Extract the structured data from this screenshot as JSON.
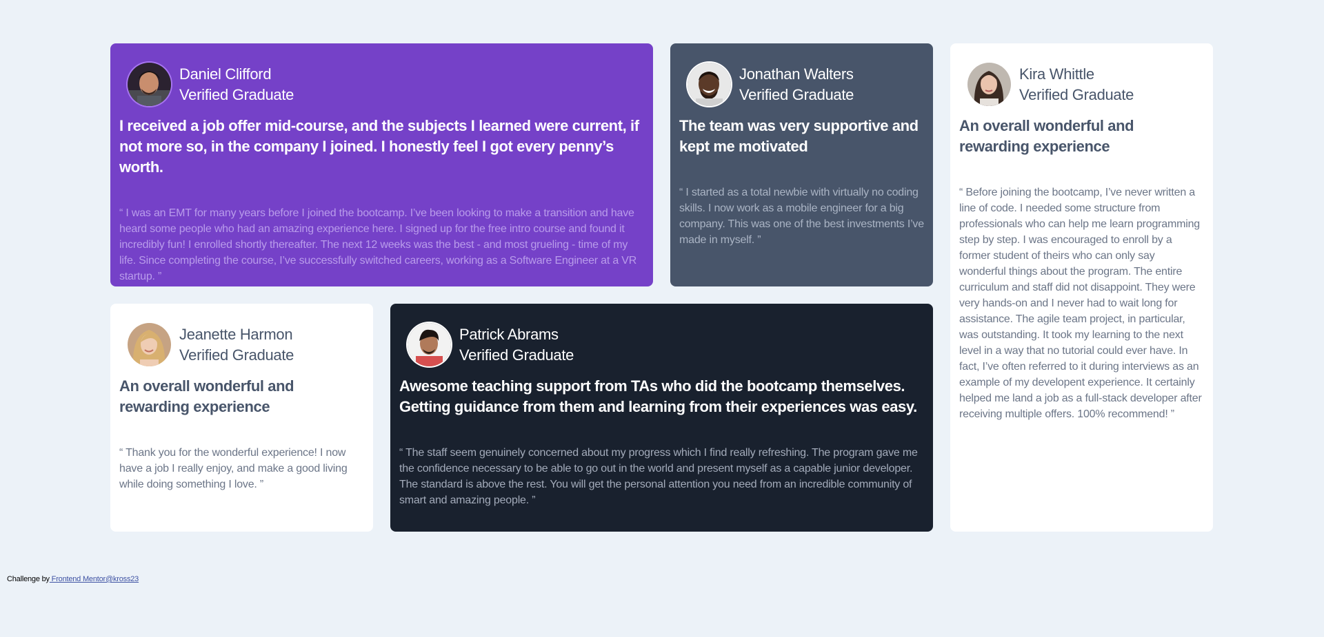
{
  "testimonials": [
    {
      "name": "Daniel Clifford",
      "role": "Verified Graduate",
      "headline": "I received a job offer mid-course, and the subjects I learned were current, if not more so, in the company I joined. I honestly feel I got every penny’s worth.",
      "quote": "“ I was an EMT for many years before I joined the bootcamp. I’ve been looking to make a transition and have heard some people who had an amazing experience here. I signed up for the free intro course and found it incredibly fun! I enrolled shortly thereafter. The next 12 weeks was the best - and most grueling - time of my life. Since completing the course, I’ve successfully switched careers, working as a Software Engineer at a VR startup. ”",
      "background": "#7541c8"
    },
    {
      "name": "Jonathan Walters",
      "role": "Verified Graduate",
      "headline": "The team was very supportive and kept me motivated",
      "quote": "“ I started as a total newbie with virtually no coding skills. I now work as a mobile engineer for a big company. This was one of the best investments I’ve made in myself. ”",
      "background": "#48556a"
    },
    {
      "name": "Kira Whittle",
      "role": "Verified Graduate",
      "headline": "An overall wonderful and rewarding experience",
      "quote": "“ Before joining the bootcamp, I’ve never written a line of code. I needed some structure from professionals who can help me learn programming step by step. I was encouraged to enroll by a former student of theirs who can only say wonderful things about the program. The entire curriculum and staff did not disappoint. They were very hands-on and I never had to wait long for assistance. The agile team project, in particular, was outstanding. It took my learning to the next level in a way that no tutorial could ever have. In fact, I’ve often referred to it during interviews as an example of my developent experience. It certainly helped me land a job as a full-stack developer after receiving multiple offers. 100% recommend! ”",
      "background": "#ffffff"
    },
    {
      "name": "Jeanette Harmon",
      "role": "Verified Graduate",
      "headline": "An overall wonderful and rewarding experience",
      "quote": "“ Thank you for the wonderful experience! I now have a job I really enjoy, and make a good living while doing something I love. ”",
      "background": "#ffffff"
    },
    {
      "name": "Patrick Abrams",
      "role": "Verified Graduate",
      "headline": "Awesome teaching support from TAs who did the bootcamp themselves. Getting guidance from them and learning from their experiences was easy.",
      "quote": "“ The staff seem genuinely concerned about my progress which I find really refreshing. The program gave me the confidence necessary to be able to go out in the world and present myself as a capable junior developer. The standard is above the rest. You will get the personal attention you need from an incredible community of smart and amazing people. ”",
      "background": "#19212e"
    }
  ],
  "attribution": {
    "prefix": "Challenge by",
    "link1": " Frontend Mentor",
    "link2": "@kross23"
  }
}
